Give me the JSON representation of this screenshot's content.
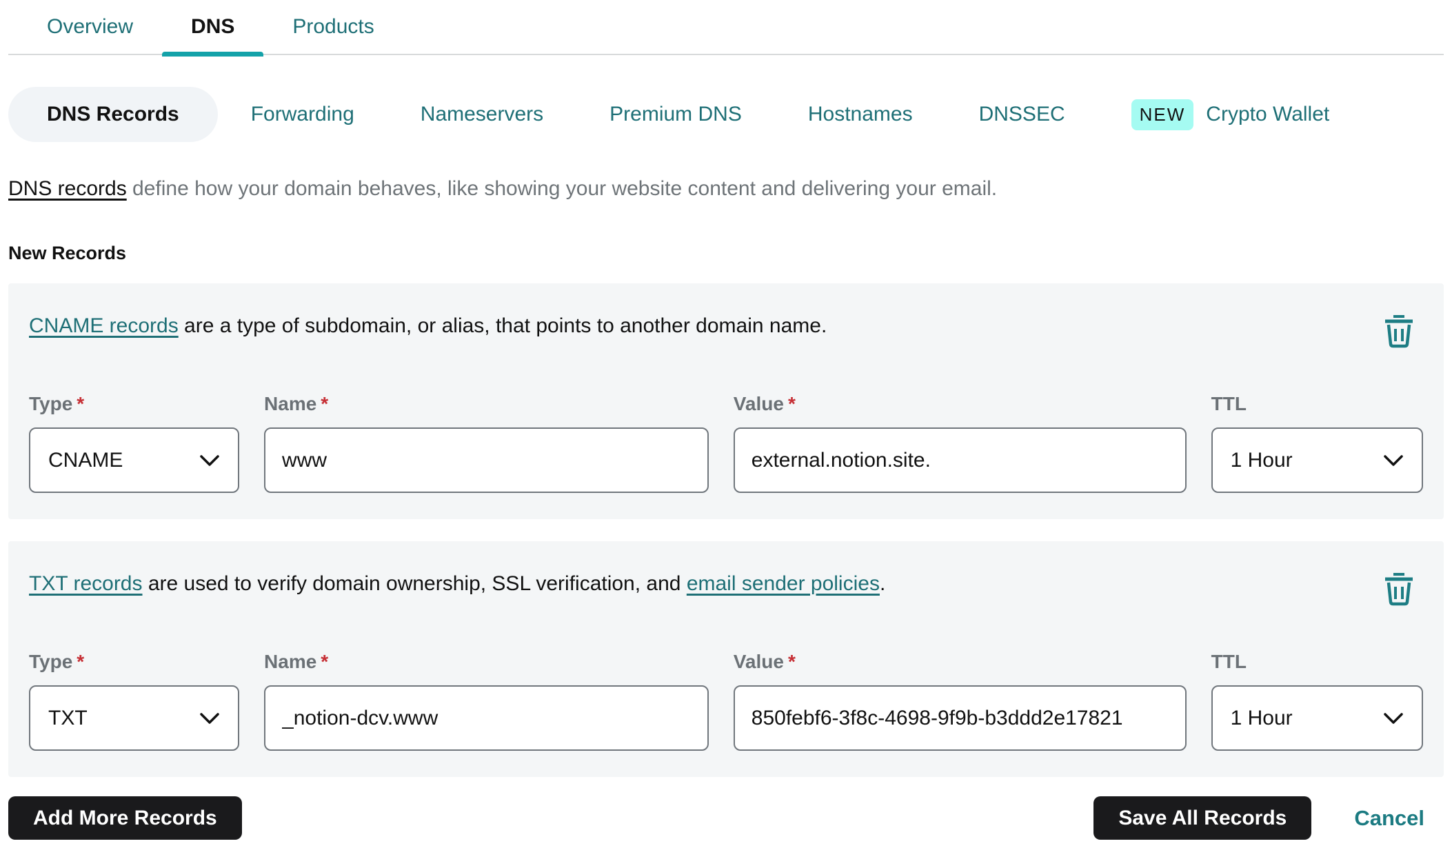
{
  "colors": {
    "accent_teal": "#14a2a9",
    "link_teal": "#1e6f76",
    "badge_bg": "#a5fbf2",
    "card_bg": "#f4f6f7",
    "active_pill_bg": "#f1f4f7",
    "field_border": "#70767c",
    "label_gray": "#6b7176",
    "intro_gray": "#6e7478",
    "required_red": "#c62f35",
    "button_black": "#1a1a1c"
  },
  "topnav": {
    "tabs": [
      {
        "label": "Overview",
        "active": false
      },
      {
        "label": "DNS",
        "active": true
      },
      {
        "label": "Products",
        "active": false
      }
    ]
  },
  "subnav": {
    "items": [
      {
        "label": "DNS Records",
        "active": true
      },
      {
        "label": "Forwarding"
      },
      {
        "label": "Nameservers"
      },
      {
        "label": "Premium DNS"
      },
      {
        "label": "Hostnames"
      },
      {
        "label": "DNSSEC"
      },
      {
        "label": "Crypto Wallet",
        "badge": "NEW"
      }
    ]
  },
  "intro": {
    "link": "DNS records",
    "text": " define how your domain behaves, like showing your website content and delivering your email."
  },
  "section_title": "New Records",
  "required_mark": "*",
  "records": [
    {
      "description": {
        "link1": "CNAME records",
        "middle": " are a type of subdomain, or alias, that points to another domain name.",
        "link2": "",
        "end": ""
      },
      "type": {
        "label": "Type",
        "value": "CNAME",
        "required": "*"
      },
      "name": {
        "label": "Name",
        "value": "www",
        "required": "*"
      },
      "value": {
        "label": "Value",
        "value": "external.notion.site.",
        "required": "*"
      },
      "ttl": {
        "label": "TTL",
        "value": "1 Hour",
        "required": ""
      }
    },
    {
      "description": {
        "link1": "TXT records",
        "middle": " are used to verify domain ownership, SSL verification, and ",
        "link2": "email sender policies",
        "end": "."
      },
      "type": {
        "label": "Type",
        "value": "TXT",
        "required": "*"
      },
      "name": {
        "label": "Name",
        "value": "_notion-dcv.www",
        "required": "*"
      },
      "value": {
        "label": "Value",
        "value": "850febf6-3f8c-4698-9f9b-b3ddd2e17821",
        "required": "*"
      },
      "ttl": {
        "label": "TTL",
        "value": "1 Hour",
        "required": ""
      }
    }
  ],
  "actions": {
    "add": "Add More Records",
    "save": "Save All Records",
    "cancel": "Cancel"
  }
}
